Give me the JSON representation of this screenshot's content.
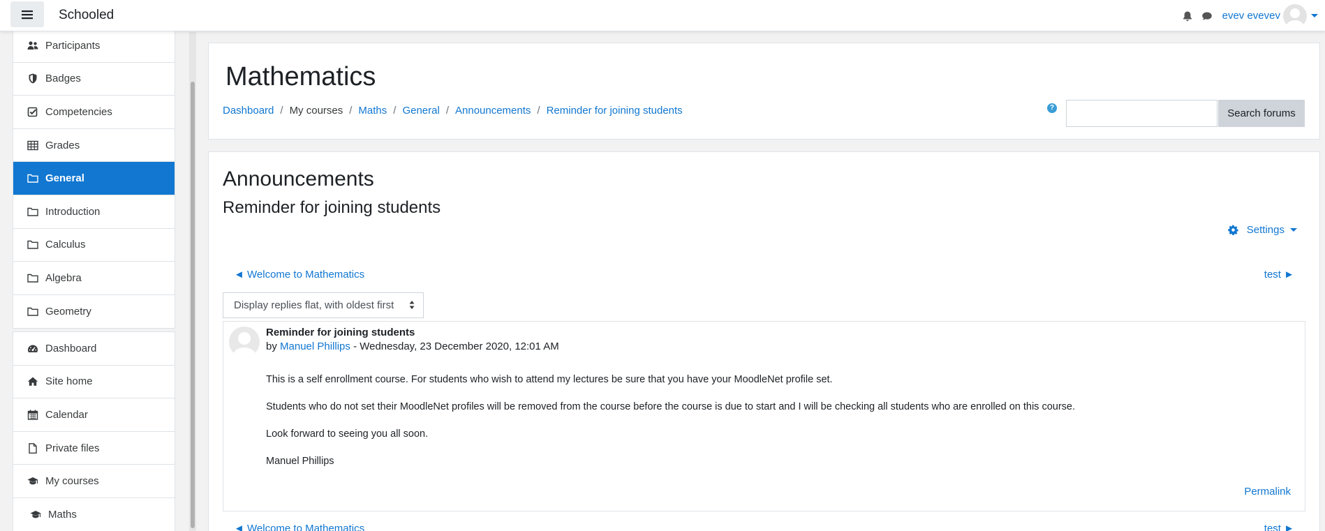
{
  "navbar": {
    "brand": "Schooled",
    "user_name": "evev evevev",
    "icons": [
      "menu-icon",
      "bell-icon",
      "chat-icon",
      "avatar-icon",
      "caret-down-icon"
    ]
  },
  "sidebar": {
    "course_items": [
      {
        "label": "Participants",
        "icon": "users-icon"
      },
      {
        "label": "Badges",
        "icon": "shield-icon"
      },
      {
        "label": "Competencies",
        "icon": "check-square-icon"
      },
      {
        "label": "Grades",
        "icon": "table-icon"
      },
      {
        "label": "General",
        "icon": "folder-icon",
        "active": true
      },
      {
        "label": "Introduction",
        "icon": "folder-icon"
      },
      {
        "label": "Calculus",
        "icon": "folder-icon"
      },
      {
        "label": "Algebra",
        "icon": "folder-icon"
      },
      {
        "label": "Geometry",
        "icon": "folder-icon"
      }
    ],
    "site_items": [
      {
        "label": "Dashboard",
        "icon": "tachometer-icon"
      },
      {
        "label": "Site home",
        "icon": "home-icon"
      },
      {
        "label": "Calendar",
        "icon": "calendar-icon"
      },
      {
        "label": "Private files",
        "icon": "file-icon"
      },
      {
        "label": "My courses",
        "icon": "graduation-cap-icon"
      },
      {
        "label": "Maths",
        "icon": "graduation-cap-icon"
      }
    ]
  },
  "header": {
    "course_title": "Mathematics",
    "breadcrumb": [
      {
        "label": "Dashboard",
        "link": true
      },
      {
        "label": "My courses",
        "link": false
      },
      {
        "label": "Maths",
        "link": true
      },
      {
        "label": "General",
        "link": true
      },
      {
        "label": "Announcements",
        "link": true
      },
      {
        "label": "Reminder for joining students",
        "link": true
      }
    ],
    "help_glyph": "?",
    "search_placeholder": "",
    "search_button": "Search forums"
  },
  "content": {
    "forum_title": "Announcements",
    "discussion_title": "Reminder for joining students",
    "settings_label": "Settings",
    "prev_discussion": "◄ Welcome to Mathematics",
    "next_discussion": "test ►",
    "display_mode": "Display replies flat, with oldest first",
    "post": {
      "subject": "Reminder for joining students",
      "by_prefix": "by ",
      "author": "Manuel Phillips",
      "date": " - Wednesday, 23 December 2020, 12:01 AM",
      "paragraphs": [
        "This is a self enrollment course. For students who wish to attend my lectures be sure that you have your MoodleNet profile set.",
        "Students who do not set their MoodleNet profiles will be  removed from the course before the course is due to start and I will be checking all students who are enrolled on this course.",
        "Look forward to seeing you all soon.",
        "Manuel Phillips"
      ],
      "permalink": "Permalink"
    }
  },
  "colors": {
    "accent": "#1177d1",
    "text": "#1d2125",
    "border": "#dee2e6",
    "background": "#f2f2f2"
  }
}
